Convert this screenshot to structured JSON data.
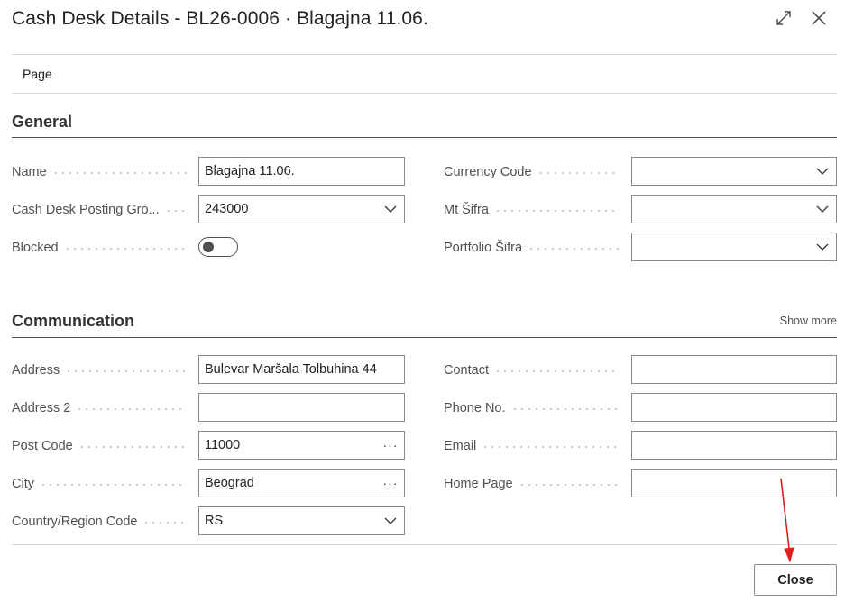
{
  "window": {
    "title": "Cash Desk Details - BL26-0006 · Blagajna 11.06.",
    "expand_icon": "expand-icon",
    "close_icon": "close-icon"
  },
  "tabs": {
    "page": "Page"
  },
  "general": {
    "title": "General",
    "left": [
      {
        "label": "Name",
        "value": "Blagajna 11.06.",
        "kind": "text"
      },
      {
        "label": "Cash Desk Posting Gro...",
        "value": "243000",
        "kind": "select"
      },
      {
        "label": "Blocked",
        "value": "off",
        "kind": "toggle"
      }
    ],
    "right": [
      {
        "label": "Currency Code",
        "value": "",
        "kind": "select"
      },
      {
        "label": "Mt Šifra",
        "value": "",
        "kind": "select"
      },
      {
        "label": "Portfolio Šifra",
        "value": "",
        "kind": "select"
      }
    ]
  },
  "communication": {
    "title": "Communication",
    "show_more": "Show more",
    "left": [
      {
        "label": "Address",
        "value": "Bulevar Maršala Tolbuhina 44",
        "kind": "text"
      },
      {
        "label": "Address 2",
        "value": "",
        "kind": "text"
      },
      {
        "label": "Post Code",
        "value": "11000",
        "kind": "lookup"
      },
      {
        "label": "City",
        "value": "Beograd",
        "kind": "lookup"
      },
      {
        "label": "Country/Region Code",
        "value": "RS",
        "kind": "select"
      }
    ],
    "right": [
      {
        "label": "Contact",
        "value": "",
        "kind": "text"
      },
      {
        "label": "Phone No.",
        "value": "",
        "kind": "text"
      },
      {
        "label": "Email",
        "value": "",
        "kind": "text"
      },
      {
        "label": "Home Page",
        "value": "",
        "kind": "text"
      }
    ]
  },
  "footer": {
    "close_label": "Close"
  },
  "lookup_glyph": "···",
  "colors": {
    "annotation_arrow": "#e02020",
    "section_line": "#505050"
  }
}
